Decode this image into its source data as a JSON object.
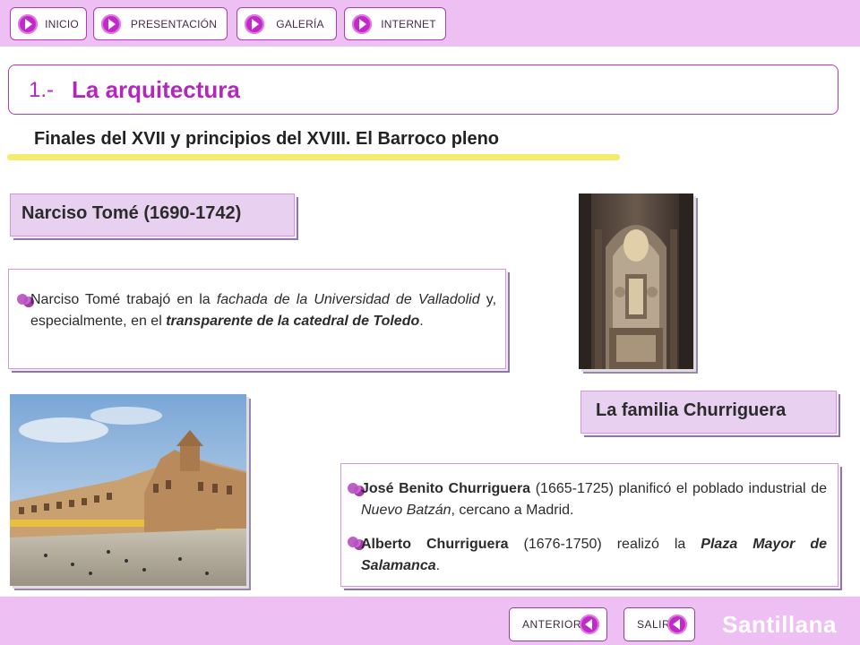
{
  "nav": {
    "inicio": "INICIO",
    "presentacion": "PRESENTACIÓN",
    "galeria": "GALERÍA",
    "internet": "INTERNET"
  },
  "title": {
    "number": "1.-",
    "text": "La arquitectura"
  },
  "subtitle": "Finales del XVII y principios del XVIII. El Barroco pleno",
  "tome": {
    "heading": "Narciso Tomé (1690-1742)",
    "p_a": "Narciso Tomé trabajó en la ",
    "p_b": "fachada de la Universidad de Valladolid",
    "p_c": " y, especialmente, en el ",
    "p_d": "transparente de la catedral de Toledo",
    "p_e": "."
  },
  "churriguera": {
    "heading": "La familia Churriguera",
    "i1_a": "José Benito Churriguera",
    "i1_b": " (1665-1725) planificó el poblado industrial de ",
    "i1_c": "Nuevo Batzán",
    "i1_d": ", cercano a Madrid.",
    "i2_a": "Alberto Churriguera",
    "i2_b": " (1676-1750) realizó la ",
    "i2_c": "Plaza Mayor de Salamanca",
    "i2_d": "."
  },
  "footer": {
    "anterior": "ANTERIOR",
    "salir": "SALIR",
    "brand": "Santillana"
  },
  "colors": {
    "accent": "#b128bb",
    "band": "#eebff2",
    "highlight": "#f2ed6e"
  }
}
